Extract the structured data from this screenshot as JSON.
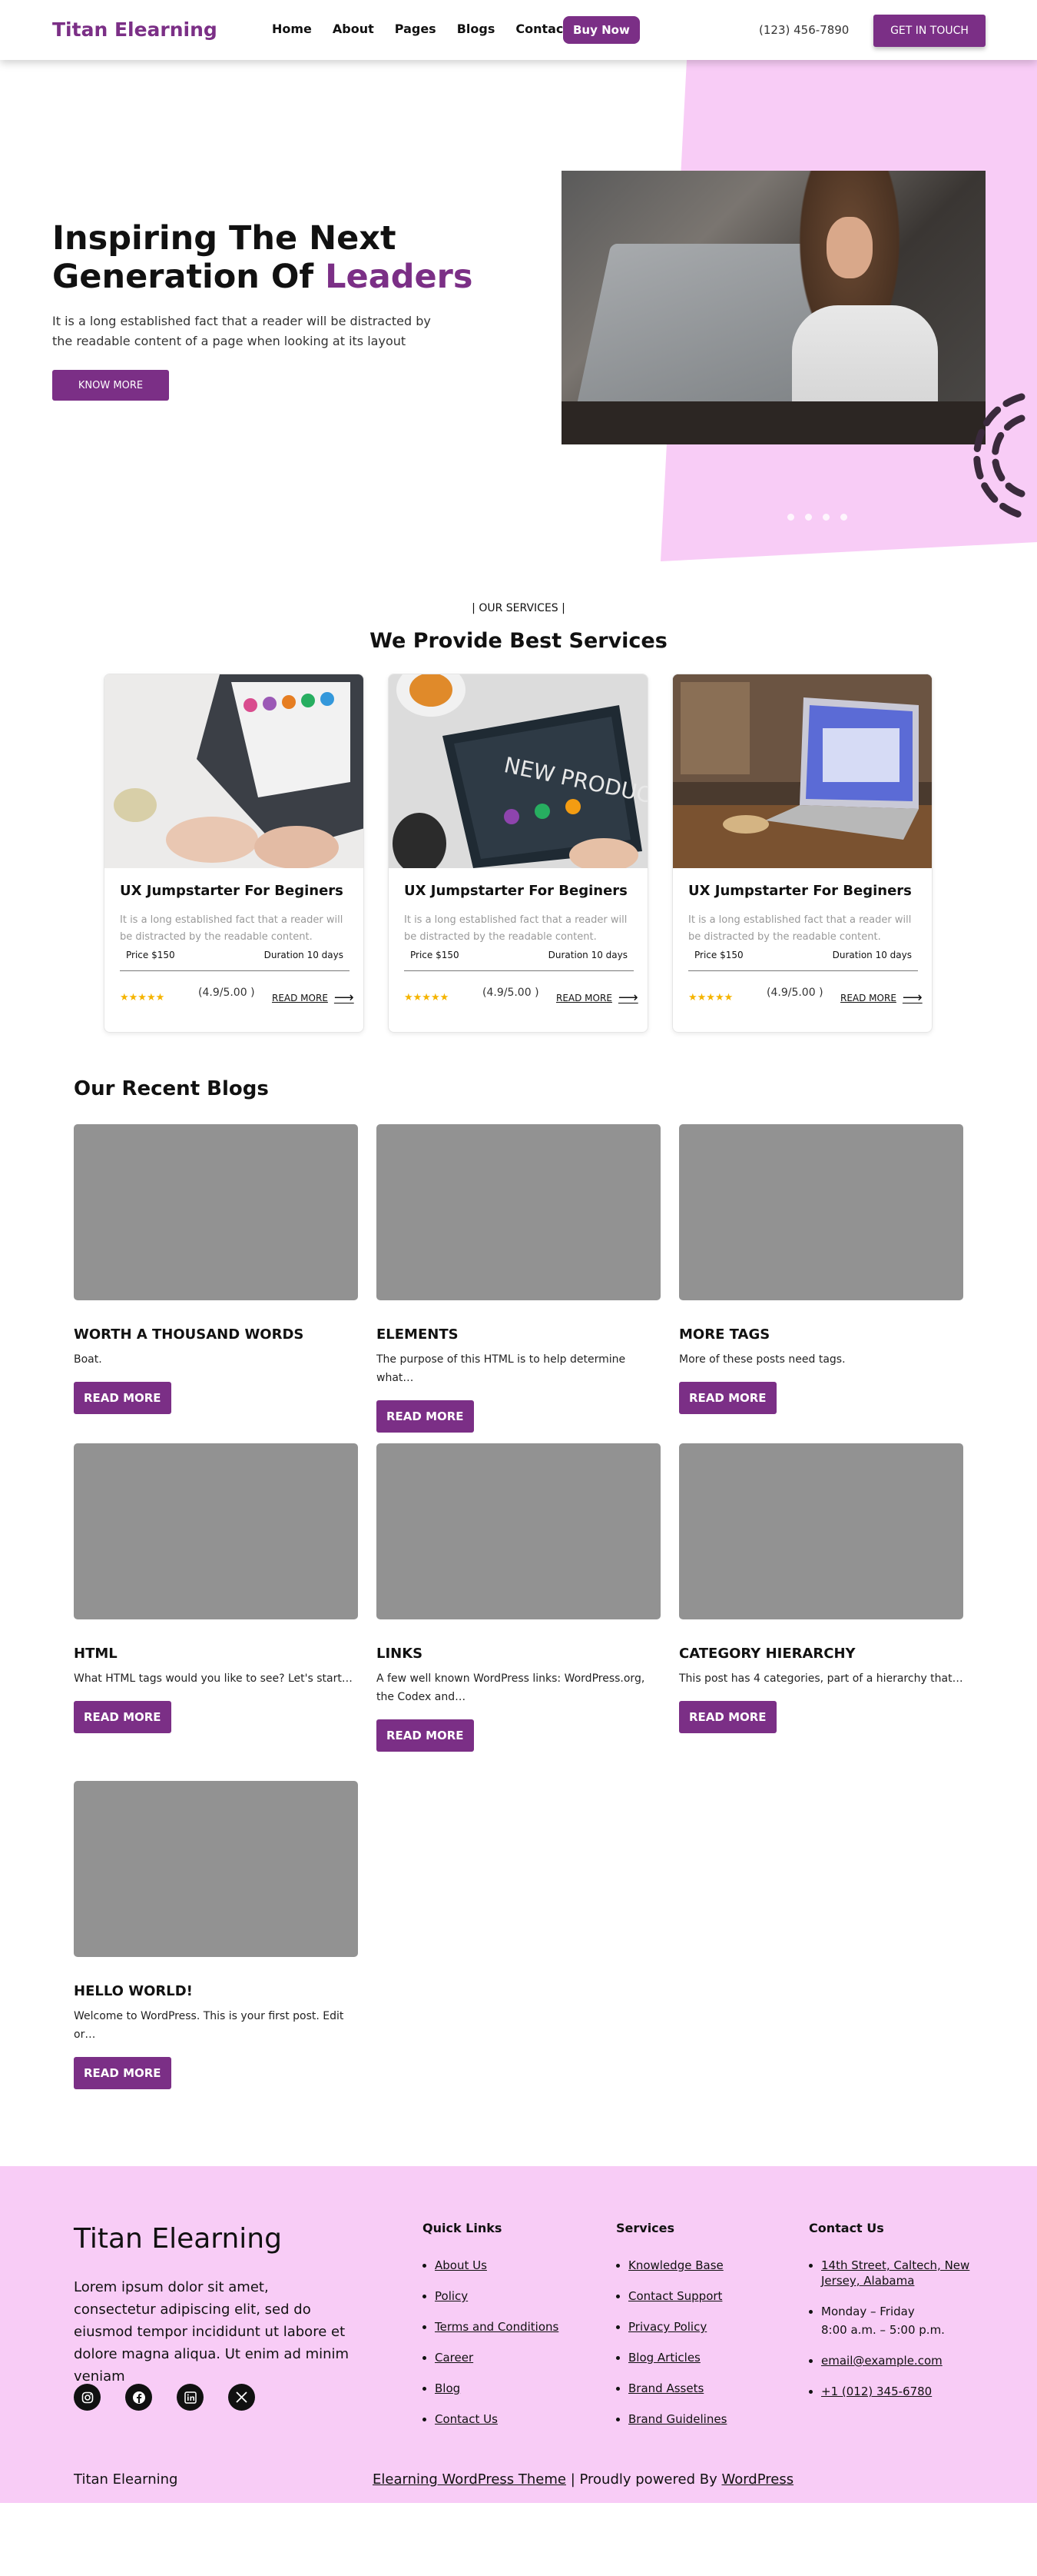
{
  "header": {
    "logo": "Titan Elearning",
    "nav": [
      "Home",
      "About",
      "Pages",
      "Blogs",
      "Contact"
    ],
    "buy_label": "Buy Now",
    "phone": "(123) 456-7890",
    "cta_label": "GET IN TOUCH"
  },
  "hero": {
    "title_line1": "Inspiring The Next",
    "title_line2": "Generation Of",
    "title_accent": "Leaders",
    "text": "It is a long established fact that a reader will be distracted by the readable content of a page when looking at its layout",
    "button": "KNOW MORE",
    "slides": 4
  },
  "services": {
    "tag": "|   OUR SERVICES   |",
    "title": "We Provide Best Services",
    "cards": [
      {
        "title": "UX Jumpstarter For Beginers",
        "desc": "It is a long established fact that a reader will be distracted by the readable content.",
        "price": "Price $150",
        "duration": "Duration 10 days",
        "rating": "(4.9/5.00 )",
        "read_more": "READ MORE"
      },
      {
        "title": "UX Jumpstarter For Beginers",
        "desc": "It is a long established fact that a reader will be distracted by the readable content.",
        "price": "Price $150",
        "duration": "Duration 10 days",
        "rating": "(4.9/5.00 )",
        "read_more": "READ MORE"
      },
      {
        "title": "UX Jumpstarter For Beginers",
        "desc": "It is a long established fact that a reader will be distracted by the readable content.",
        "price": "Price $150",
        "duration": "Duration 10 days",
        "rating": "(4.9/5.00 )",
        "read_more": "READ MORE"
      }
    ]
  },
  "blogs": {
    "title": "Our Recent Blogs",
    "button": "READ MORE",
    "posts": [
      {
        "title": "WORTH A THOUSAND WORDS",
        "excerpt": "Boat."
      },
      {
        "title": "ELEMENTS",
        "excerpt": "The purpose of this HTML is to help determine what…"
      },
      {
        "title": "MORE TAGS",
        "excerpt": "More of these posts need tags."
      },
      {
        "title": "HTML",
        "excerpt": "What HTML tags would you like to see? Let's start…"
      },
      {
        "title": "LINKS",
        "excerpt": "A few well known WordPress links: WordPress.org, the Codex and…"
      },
      {
        "title": "CATEGORY HIERARCHY",
        "excerpt": "This post has 4 categories, part of a hierarchy that…"
      },
      {
        "title": "HELLO WORLD!",
        "excerpt": "Welcome to WordPress. This is your first post. Edit or…"
      }
    ]
  },
  "footer": {
    "brand": "Titan Elearning",
    "text": "Lorem ipsum dolor sit amet, consectetur adipiscing elit, sed do eiusmod tempor incididunt ut labore et dolore magna aliqua. Ut enim ad minim veniam",
    "social_icons": [
      "instagram-icon",
      "facebook-icon",
      "linkedin-icon",
      "x-icon"
    ],
    "quick_links": {
      "title": "Quick Links",
      "items": [
        "About Us",
        "Policy",
        "Terms and Conditions",
        "Career",
        "Blog",
        "Contact Us"
      ]
    },
    "services": {
      "title": "Services",
      "items": [
        "Knowledge Base",
        "Contact Support",
        "Privacy Policy",
        "Blog Articles",
        "Brand Assets",
        "Brand Guidelines"
      ]
    },
    "contact": {
      "title": "Contact Us",
      "address": "14th Street, Caltech, New Jersey, Alabama",
      "hours_days": "Monday – Friday",
      "hours_time": "8:00 a.m. – 5:00 p.m.",
      "email": "email@example.com",
      "phone": "+1 (012) 345-6780"
    },
    "bottom_brand": "Titan Elearning",
    "credit_link": "Elearning WordPress Theme",
    "credit_sep": " | Proudly powered By ",
    "credit_wp": "WordPress"
  },
  "colors": {
    "accent": "#7b2f86",
    "pink": "#f8ccf6",
    "placeholder": "#929292",
    "star": "#f5b400"
  }
}
